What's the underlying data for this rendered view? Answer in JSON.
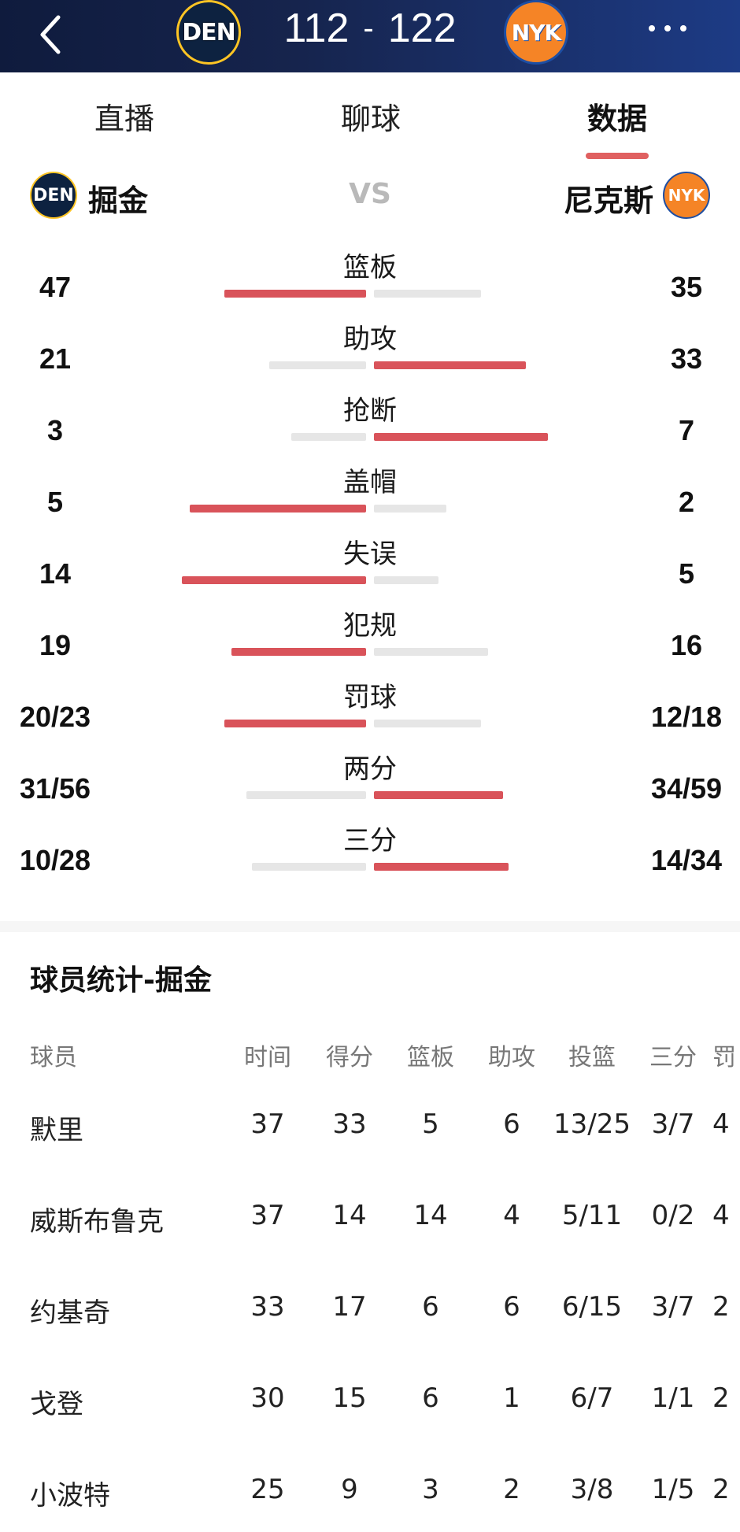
{
  "header": {
    "home_logo_text": "DEN",
    "away_logo_text": "NYK",
    "home_score": "112",
    "separator": "-",
    "away_score": "122"
  },
  "tabs": [
    {
      "label": "直播",
      "active": false
    },
    {
      "label": "聊球",
      "active": false
    },
    {
      "label": "数据",
      "active": true
    }
  ],
  "teams": {
    "home": "掘金",
    "vs": "VS",
    "away": "尼克斯"
  },
  "stats": [
    {
      "label": "篮板",
      "home": "47",
      "away": "35",
      "home_fraction": 0.57,
      "away_fraction": 0.43,
      "leader": "home"
    },
    {
      "label": "助攻",
      "home": "21",
      "away": "33",
      "home_fraction": 0.39,
      "away_fraction": 0.61,
      "leader": "away"
    },
    {
      "label": "抢断",
      "home": "3",
      "away": "7",
      "home_fraction": 0.3,
      "away_fraction": 0.7,
      "leader": "away"
    },
    {
      "label": "盖帽",
      "home": "5",
      "away": "2",
      "home_fraction": 0.71,
      "away_fraction": 0.29,
      "leader": "home"
    },
    {
      "label": "失误",
      "home": "14",
      "away": "5",
      "home_fraction": 0.74,
      "away_fraction": 0.26,
      "leader": "home"
    },
    {
      "label": "犯规",
      "home": "19",
      "away": "16",
      "home_fraction": 0.54,
      "away_fraction": 0.46,
      "leader": "home"
    },
    {
      "label": "罚球",
      "home": "20/23",
      "away": "12/18",
      "home_fraction": 0.57,
      "away_fraction": 0.43,
      "leader": "home"
    },
    {
      "label": "两分",
      "home": "31/56",
      "away": "34/59",
      "home_fraction": 0.48,
      "away_fraction": 0.52,
      "leader": "away"
    },
    {
      "label": "三分",
      "home": "10/28",
      "away": "14/34",
      "home_fraction": 0.46,
      "away_fraction": 0.54,
      "leader": "away"
    }
  ],
  "player_stats": {
    "title": "球员统计-掘金",
    "columns": [
      "球员",
      "时间",
      "得分",
      "篮板",
      "助攻",
      "投篮",
      "三分",
      "罚"
    ],
    "rows": [
      [
        "默里",
        "37",
        "33",
        "5",
        "6",
        "13/25",
        "3/7",
        "4"
      ],
      [
        "威斯布鲁克",
        "37",
        "14",
        "14",
        "4",
        "5/11",
        "0/2",
        "4"
      ],
      [
        "约基奇",
        "33",
        "17",
        "6",
        "6",
        "6/15",
        "3/7",
        "2"
      ],
      [
        "戈登",
        "30",
        "15",
        "6",
        "1",
        "6/7",
        "1/1",
        "2"
      ],
      [
        "小波特",
        "25",
        "9",
        "3",
        "2",
        "3/8",
        "1/5",
        "2"
      ]
    ]
  },
  "colors": {
    "header_bg": "#16244d",
    "accent": "#d9535a",
    "bar_grey": "#e6e6e6"
  }
}
